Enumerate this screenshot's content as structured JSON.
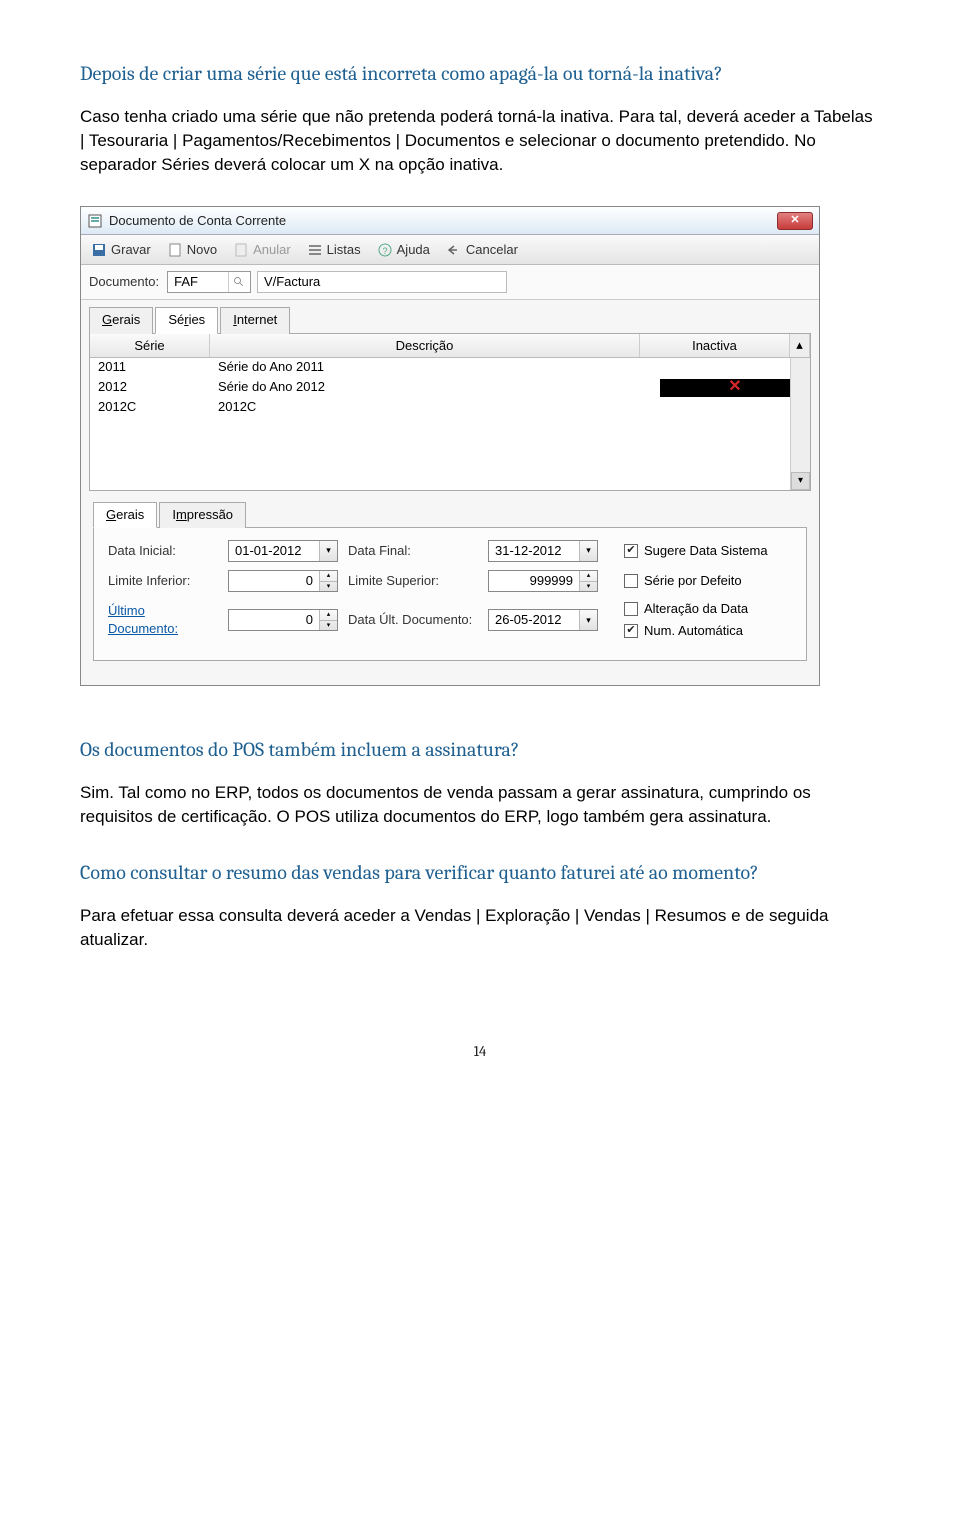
{
  "q1": {
    "title": "Depois de criar uma série que está incorreta como apagá-la ou torná-la inativa?",
    "answer": "Caso tenha criado uma série que não pretenda poderá torná-la inativa. Para tal, deverá aceder a Tabelas | Tesouraria | Pagamentos/Recebimentos | Documentos e selecionar o documento pretendido. No separador Séries deverá colocar um X na opção inativa."
  },
  "window": {
    "title": "Documento de Conta Corrente",
    "toolbar": {
      "gravar": "Gravar",
      "novo": "Novo",
      "anular": "Anular",
      "listas": "Listas",
      "ajuda": "Ajuda",
      "cancelar": "Cancelar"
    },
    "doc_label": "Documento:",
    "doc_code": "FAF",
    "doc_name": "V/Factura",
    "tabs_top": {
      "gerais": "Gerais",
      "series": "Séries",
      "internet": "Internet"
    },
    "grid": {
      "col_serie": "Série",
      "col_desc": "Descrição",
      "col_ina": "Inactiva",
      "rows": [
        {
          "serie": "2011",
          "desc": "Série do Ano 2011",
          "x": false
        },
        {
          "serie": "2012",
          "desc": "Série do Ano 2012",
          "x": true
        },
        {
          "serie": "2012C",
          "desc": "2012C",
          "x": false
        }
      ]
    },
    "tabs_bottom": {
      "gerais": "Gerais",
      "impressao": "Impressão"
    },
    "fields": {
      "data_inicial_label": "Data Inicial:",
      "data_inicial": "01-01-2012",
      "data_final_label": "Data Final:",
      "data_final": "31-12-2012",
      "lim_inf_label": "Limite Inferior:",
      "lim_inf": "0",
      "lim_sup_label": "Limite Superior:",
      "lim_sup": "999999",
      "ult_doc_label": "Último Documento:",
      "ult_doc": "0",
      "data_ult_label": "Data Últ. Documento:",
      "data_ult": "26-05-2012"
    },
    "checks": {
      "sugere": "Sugere Data Sistema",
      "defeito": "Série por Defeito",
      "altera": "Alteração da Data",
      "numauto": "Num. Automática"
    },
    "checked": {
      "sugere": "✔",
      "numauto": "✔"
    }
  },
  "q2": {
    "title": "Os documentos do POS também incluem a assinatura?",
    "answer": "Sim. Tal como no ERP, todos os documentos de venda passam a gerar assinatura, cumprindo os requisitos de certificação. O POS utiliza documentos do ERP, logo também gera assinatura."
  },
  "q3": {
    "title": "Como consultar o resumo das vendas para verificar quanto faturei até ao momento?",
    "answer": "Para efetuar essa consulta deverá aceder a Vendas | Exploração | Vendas | Resumos e de seguida atualizar."
  },
  "page": "14"
}
